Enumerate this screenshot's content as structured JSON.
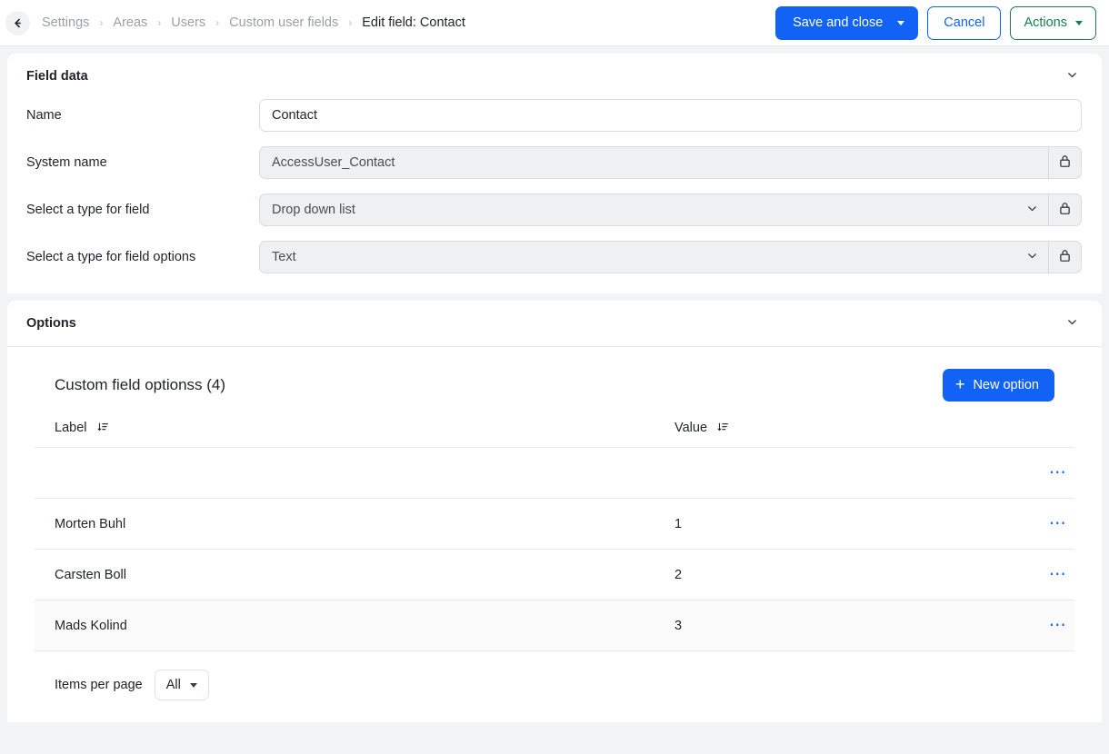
{
  "topbar": {
    "back_icon": "arrow-left-icon",
    "breadcrumb": [
      {
        "label": "Settings",
        "current": false
      },
      {
        "label": "Areas",
        "current": false
      },
      {
        "label": "Users",
        "current": false
      },
      {
        "label": "Custom user fields",
        "current": false
      },
      {
        "label": "Edit field: Contact",
        "current": true
      }
    ],
    "separator": "›",
    "save_label": "Save and close",
    "cancel_label": "Cancel",
    "actions_label": "Actions",
    "colors": {
      "primary": "#1263f5",
      "actions_green": "#14804a"
    }
  },
  "field_data": {
    "title": "Field data",
    "collapse_icon": "chevron-down-icon",
    "lock_icon": "lock-icon",
    "rows": [
      {
        "label": "Name",
        "value": "Contact",
        "type": "input",
        "disabled": false,
        "lock": false
      },
      {
        "label": "System name",
        "value": "AccessUser_Contact",
        "type": "input",
        "disabled": true,
        "lock": true
      },
      {
        "label": "Select a type for field",
        "value": "Drop down list",
        "type": "select",
        "disabled": true,
        "lock": true
      },
      {
        "label": "Select a type for field options",
        "value": "Text",
        "type": "select",
        "disabled": true,
        "lock": true
      }
    ]
  },
  "options": {
    "title": "Options",
    "collapse_icon": "chevron-down-icon",
    "table_title": "Custom field optionss (4)",
    "new_option_label": "New option",
    "new_option_icon": "plus-icon",
    "row_menu_icon": "ellipsis-icon",
    "columns": [
      {
        "label": "Label",
        "sort_icon": "sort-descending-icon"
      },
      {
        "label": "Value",
        "sort_icon": "sort-descending-icon"
      }
    ],
    "rows": [
      {
        "label": "",
        "value": ""
      },
      {
        "label": "Morten Buhl",
        "value": "1"
      },
      {
        "label": "Carsten Boll",
        "value": "2"
      },
      {
        "label": "Mads Kolind",
        "value": "3"
      }
    ],
    "footer": {
      "items_per_page_label": "Items per page",
      "items_per_page_value": "All"
    }
  }
}
